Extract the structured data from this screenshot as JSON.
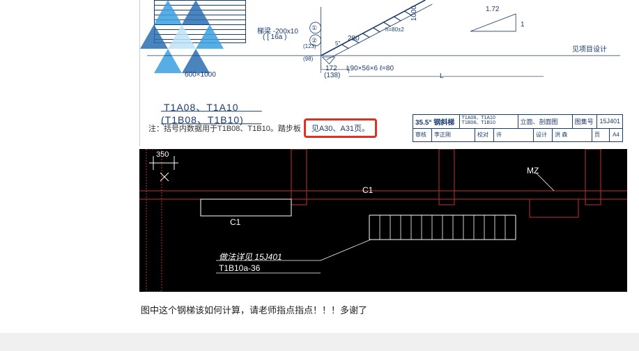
{
  "top_drawing": {
    "ladder_spec": "梯梁 -200x10",
    "ladder_spec_sub": "( [ 16a )",
    "dim_600_1000": "600×1000",
    "dim_1000": "1000",
    "dim_280": "280",
    "dim_172": "172",
    "dim_172_sub": "(138)",
    "dim_123": "(123)",
    "dim_98": "(98)",
    "dim_5": "5°",
    "dim_h": "h=80±2",
    "angle_spec": "L90×56×6  ℓ=80",
    "dim_L": "L",
    "slope_172": "1.72",
    "slope_1": "1",
    "design_ref": "见项目设计",
    "model_line1": "T1A08、T1A10",
    "model_line2": "(T1B08、T1B10)",
    "note_prefix": "注：括号内数据用于T1B08、T1B10。踏步板",
    "note_highlight": "见A30、A31页。",
    "symbol1": "①",
    "symbol2": "②"
  },
  "cartouche": {
    "angle_title": "35.5° 钢斜梯",
    "models_a": "T1A08、T1A10",
    "models_b": "T1B08、T1B10",
    "view_title": "立面、剖面图",
    "atlas_label": "图集号",
    "atlas_value": "15J401",
    "check_label": "审核",
    "check_name": "李正刚",
    "verify_label": "校对",
    "verify_name": "许",
    "design_label": "设计",
    "design_name": "洪 森",
    "page_label": "页",
    "page_value": "A4"
  },
  "cad": {
    "dim_350": "350",
    "label_C1_a": "C1",
    "label_C1_b": "C1",
    "label_MZ": "MZ",
    "detail_ref": "做法详见 15J401",
    "model_ref": "T1B10a-36"
  },
  "question_text": "图中这个钢梯该如何计算，请老师指点指点！！！多谢了"
}
